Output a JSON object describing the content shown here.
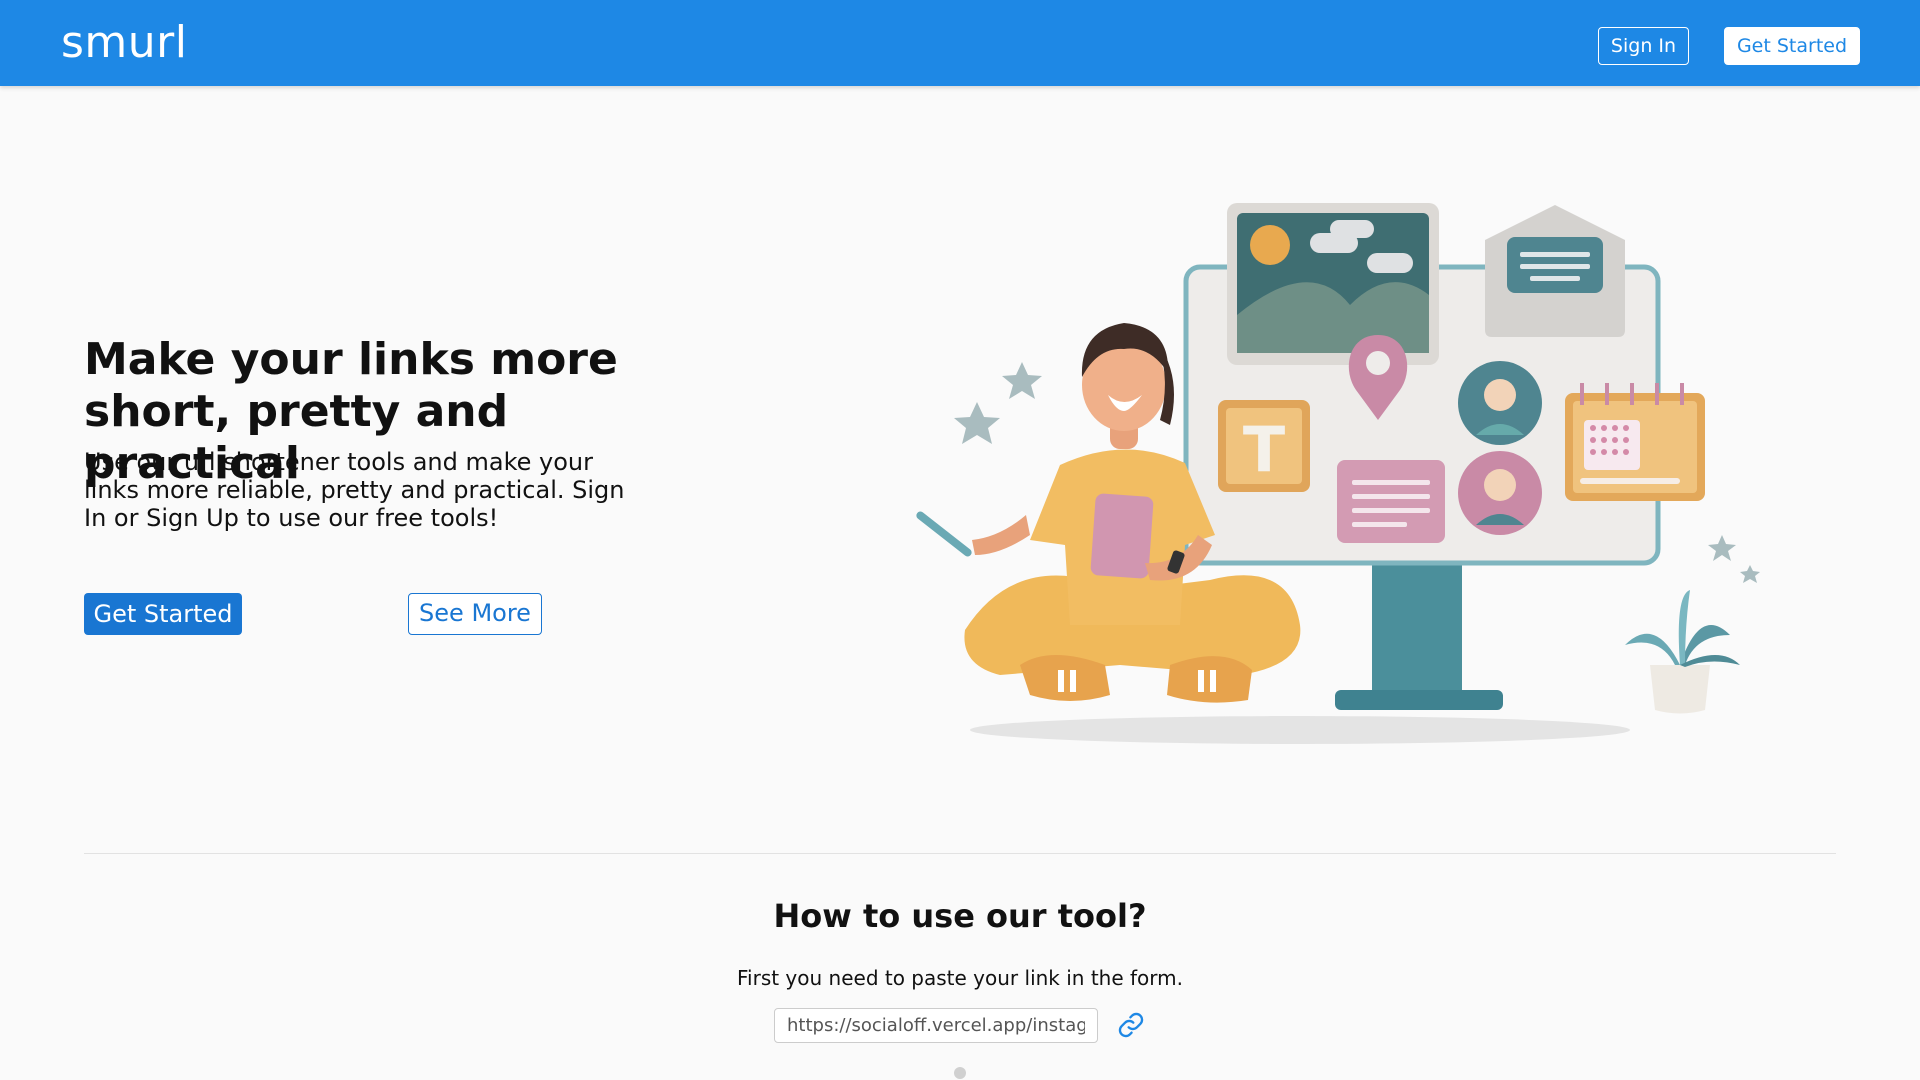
{
  "navbar": {
    "brand": "smurl",
    "sign_in": "Sign In",
    "get_started": "Get Started"
  },
  "hero": {
    "title_line1": "Make your links more",
    "title_line2": "short, pretty and practical",
    "subtitle": "Use our url shortener tools and make your links more reliable, pretty and practical. Sign In or Sign Up to use our free tools!",
    "primary_button": "Get Started",
    "secondary_button": "See More",
    "illustration_text_tile": "T"
  },
  "how_to": {
    "title": "How to use our tool?",
    "step_text": "First you need to paste your link in the form.",
    "input_value": "https://socialoff.vercel.app/instagram"
  },
  "colors": {
    "brand_blue": "#1e88e5",
    "button_blue": "#1976d2",
    "background": "#fafafa"
  },
  "icons": [
    "link-icon",
    "star-icon",
    "map-pin-icon",
    "envelope-icon",
    "calendar-icon",
    "avatar-icon",
    "plant-icon"
  ]
}
